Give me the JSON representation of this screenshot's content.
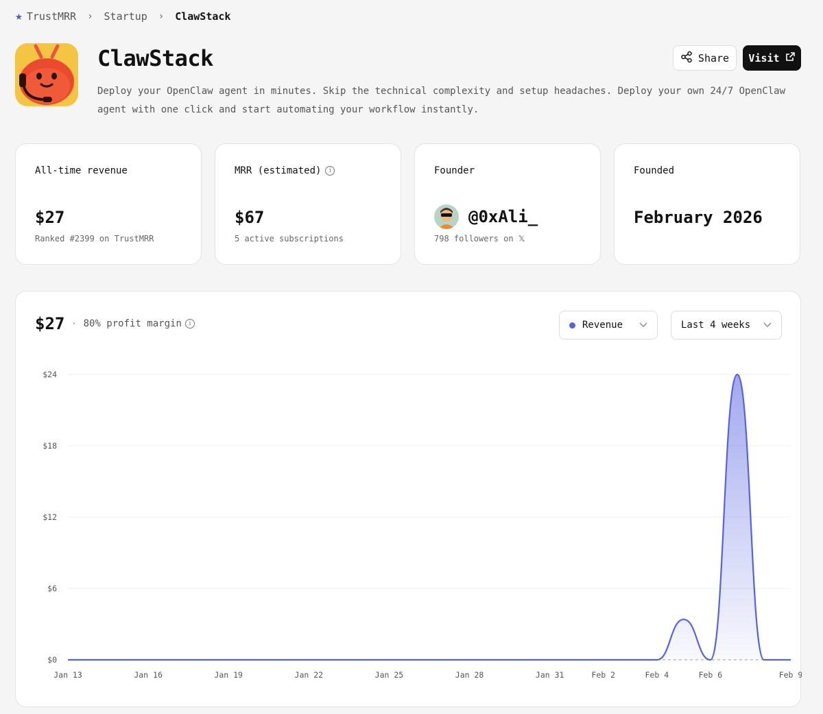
{
  "breadcrumb": {
    "items": [
      "TrustMRR",
      "Startup",
      "ClawStack"
    ]
  },
  "header": {
    "title": "ClawStack",
    "description": "Deploy your OpenClaw agent in minutes. Skip the technical complexity and setup headaches. Deploy your own 24/7 OpenClaw agent with one click and start automating your workflow instantly.",
    "share_label": "Share",
    "visit_label": "Visit"
  },
  "stats": {
    "revenue": {
      "label": "All-time revenue",
      "value": "$27",
      "sub": "Ranked #2399 on TrustMRR"
    },
    "mrr": {
      "label": "MRR (estimated)",
      "value": "$67",
      "sub": "5 active subscriptions"
    },
    "founder": {
      "label": "Founder",
      "handle": "@0xAli_",
      "sub": "798 followers on 𝕏"
    },
    "founded": {
      "label": "Founded",
      "value": "February 2026"
    }
  },
  "chart_panel": {
    "total": "$27",
    "margin": "80% profit margin",
    "metric_select": "Revenue",
    "range_select": "Last 4 weeks",
    "accent": "#5563de"
  },
  "chart_data": {
    "type": "area",
    "title": "",
    "xlabel": "",
    "ylabel": "",
    "ylim": [
      0,
      24
    ],
    "yticks": [
      "$0",
      "$6",
      "$12",
      "$18",
      "$24"
    ],
    "xtick_labels": [
      "Jan 13",
      "Jan 16",
      "Jan 19",
      "Jan 22",
      "Jan 25",
      "Jan 28",
      "Jan 31",
      "Feb 2",
      "Feb 4",
      "Feb 6",
      "Feb 9"
    ],
    "series": [
      {
        "x": [
          "Jan 13",
          "Jan 14",
          "Jan 15",
          "Jan 16",
          "Jan 17",
          "Jan 18",
          "Jan 19",
          "Jan 20",
          "Jan 21",
          "Jan 22",
          "Jan 23",
          "Jan 24",
          "Jan 25",
          "Jan 26",
          "Jan 27",
          "Jan 28",
          "Jan 29",
          "Jan 30",
          "Jan 31",
          "Feb 1",
          "Feb 2",
          "Feb 3",
          "Feb 4",
          "Feb 5",
          "Feb 6",
          "Feb 7",
          "Feb 8",
          "Feb 9"
        ],
        "values": [
          0,
          0,
          0,
          0,
          0,
          0,
          0,
          0,
          0,
          0,
          0,
          0,
          0,
          0,
          0,
          0,
          0,
          0,
          0,
          0,
          0,
          0,
          0,
          3.4,
          0,
          24,
          0,
          0
        ]
      }
    ],
    "grid": true
  }
}
